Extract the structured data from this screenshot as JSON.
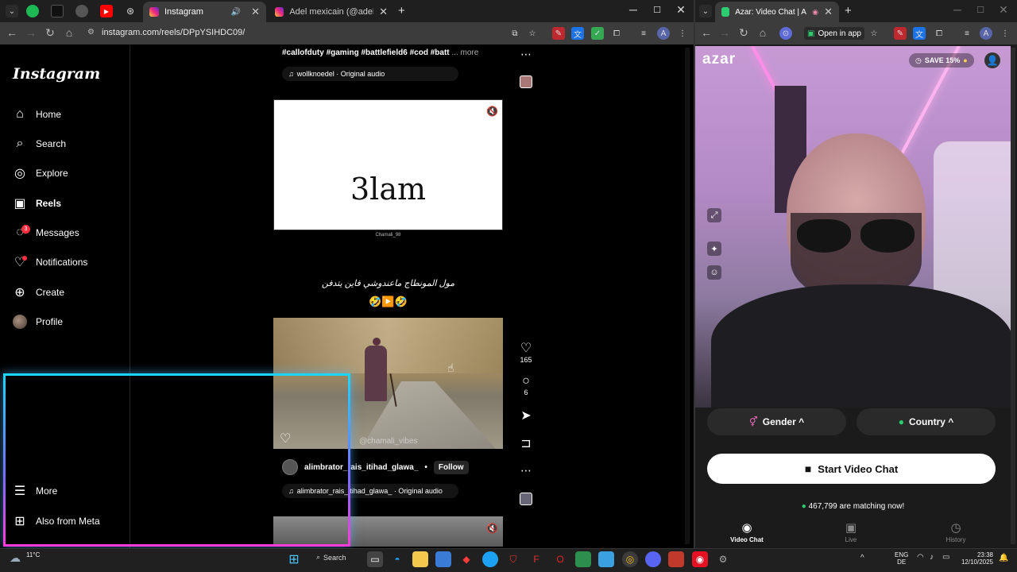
{
  "left_browser": {
    "tabs": [
      {
        "label": "Instagram",
        "active": true
      },
      {
        "label": "Adel mexicain (@adel.mexic)",
        "active": false
      }
    ],
    "url": "instagram.com/reels/DPpYSIHDC09/"
  },
  "instagram": {
    "logo": "Instagram",
    "nav": [
      {
        "label": "Home",
        "icon": "home-icon"
      },
      {
        "label": "Search",
        "icon": "search-icon"
      },
      {
        "label": "Explore",
        "icon": "compass-icon"
      },
      {
        "label": "Reels",
        "icon": "reels-icon"
      },
      {
        "label": "Messages",
        "icon": "messenger-icon"
      },
      {
        "label": "Notifications",
        "icon": "heart-icon"
      },
      {
        "label": "Create",
        "icon": "plus-icon"
      },
      {
        "label": "Profile",
        "icon": "avatar"
      }
    ],
    "messages_badge": "3",
    "bottom_nav": [
      {
        "label": "More",
        "icon": "menu-icon"
      },
      {
        "label": "Also from Meta",
        "icon": "meta-icon"
      }
    ],
    "reel1": {
      "caption": "#callofduty #gaming #battlefield6 #cod #batt",
      "more": "... more",
      "audio": "wollknoedel · Original audio"
    },
    "reel2": {
      "emojis_row1": "😂😂😂😢😭😭",
      "emojis_row2": "😭😭😭",
      "word": "3lam",
      "small_credit": "Chamali_98",
      "arabic_caption": "مول المونطاج ماعندوشي فاين يتدفن",
      "emoji_line": "🤣▶️🤣",
      "likes": "165",
      "comments": "6",
      "watermark": "@chamali_vibes",
      "username": "alimbrator_rais_itihad_glawa_",
      "follow": "Follow",
      "audio": "alimbrator_rais_itihad_glawa_ · Original audio"
    }
  },
  "right_browser": {
    "tab": "Azar: Video Chat | Alternati",
    "open_in_app": "Open in app",
    "azar": {
      "logo": "azar",
      "save": "SAVE 15%",
      "gender": "Gender ^",
      "country": "Country ^",
      "start": "Start Video Chat",
      "matching": "467,799 are matching now!",
      "nav": [
        {
          "label": "Video Chat",
          "active": true
        },
        {
          "label": "Live",
          "active": false
        },
        {
          "label": "History",
          "active": false
        }
      ]
    }
  },
  "taskbar": {
    "weather_temp": "11°C",
    "search": "Search",
    "lang1": "ENG",
    "lang2": "DE",
    "time": "23:38",
    "date": "12/10/2025"
  },
  "colors": {
    "neon_cyan": "#1ad6ff",
    "neon_pink": "#ff3ad8",
    "azar_green": "#2ecc71",
    "ig_red": "#ff3040"
  }
}
